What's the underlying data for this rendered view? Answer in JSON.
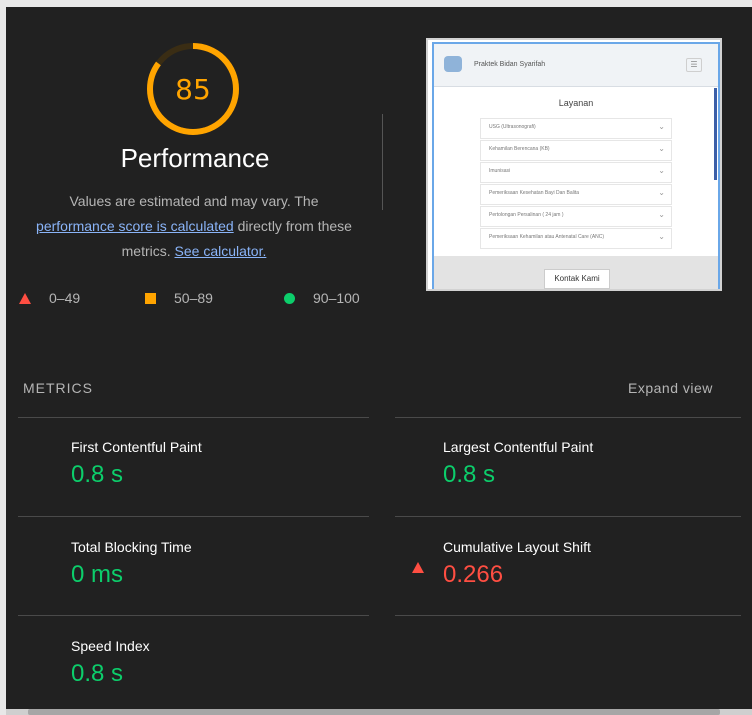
{
  "gauge": {
    "score": "85",
    "fraction": 0.85,
    "color": "#ffa400"
  },
  "performance": {
    "title": "Performance",
    "desc_1": "Values are estimated and may vary. The",
    "link_score": "performance score is calculated",
    "desc_2": "directly from these",
    "desc_3": "metrics.",
    "link_calc": "See calculator."
  },
  "legend": [
    {
      "range": "0–49",
      "color": "#ff4e42"
    },
    {
      "range": "50–89",
      "color": "#ffa400"
    },
    {
      "range": "90–100",
      "color": "#0cce6b"
    }
  ],
  "thumbnail": {
    "site_name": "Praktek Bidan Syarifah",
    "section_title": "Layanan",
    "items": [
      "USG (Ultrasonografi)",
      "Kehamilan Berencana (KB)",
      "Imunisasi",
      "Pemeriksaan Kesehatan Bayi Dan Balita",
      "Pertolongan Persalinan ( 24 jam )",
      "Pemeriksaan Kehamilan atau Antenatal Care (ANC)"
    ],
    "contact_label": "Kontak Kami"
  },
  "metrics": {
    "heading": "METRICS",
    "expand_label": "Expand view",
    "items": [
      {
        "name": "First Contentful Paint",
        "value": "0.8 s",
        "status": "good"
      },
      {
        "name": "Largest Contentful Paint",
        "value": "0.8 s",
        "status": "good"
      },
      {
        "name": "Total Blocking Time",
        "value": "0 ms",
        "status": "good"
      },
      {
        "name": "Cumulative Layout Shift",
        "value": "0.266",
        "status": "bad"
      },
      {
        "name": "Speed Index",
        "value": "0.8 s",
        "status": "good"
      }
    ]
  },
  "colors": {
    "good": "#0cce6b",
    "average": "#ffa400",
    "bad": "#ff4e42",
    "background": "#212121",
    "link": "#8ab4f8"
  }
}
